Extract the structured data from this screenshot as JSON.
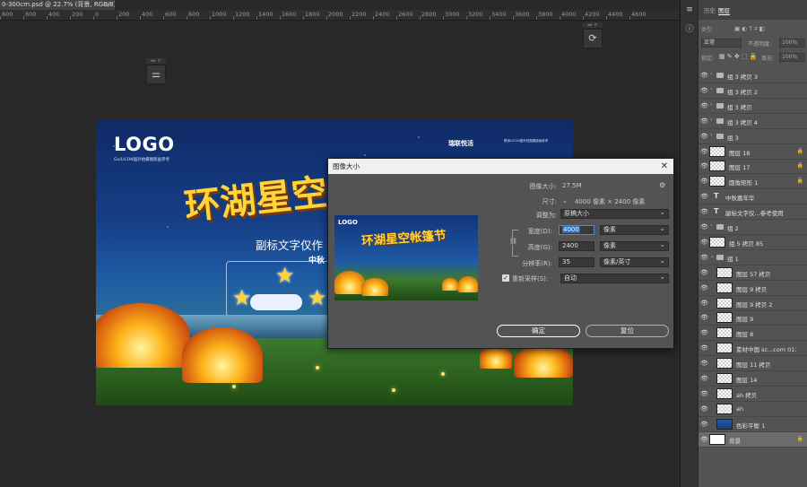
{
  "document_tab": {
    "title": "0-300cm.psd @ 22.7% (背景, RGB/8) *",
    "close": "×"
  },
  "ruler": {
    "labels": [
      "800",
      "600",
      "400",
      "200",
      "0",
      "200",
      "400",
      "600",
      "800",
      "1000",
      "1200",
      "1400",
      "1600",
      "1800",
      "2000",
      "2200",
      "2400",
      "2600",
      "2800",
      "3000",
      "3200",
      "3400",
      "3600",
      "3800",
      "4000",
      "4200",
      "4400",
      "4600"
    ]
  },
  "poster": {
    "logo": "LOGO",
    "logo_sub": "Go/LICON国外拍摄图版画参考",
    "brand": "瑞联悦活",
    "brand_sub": "联创LICON国外拍摄图版画参考",
    "title": "环湖星空",
    "subtitle": "副标文字仅作",
    "moon_title": "中秋"
  },
  "dialog": {
    "title": "图像大小",
    "image_size_label": "图像大小:",
    "image_size_value": "27.5M",
    "dimensions_label": "尺寸:",
    "dimensions_value": "4000 像素 × 2400 像素",
    "fit_label": "调整为:",
    "fit_value": "原稿大小",
    "width_label": "宽度(D):",
    "width_value": "4000",
    "width_unit": "像素",
    "height_label": "高度(G):",
    "height_value": "2400",
    "height_unit": "像素",
    "resolution_label": "分辨率(R):",
    "resolution_value": "35",
    "resolution_unit": "像素/英寸",
    "resample_label": "重新采样(S):",
    "resample_value": "自动",
    "ok_label": "确定",
    "reset_label": "复位",
    "preview_logo": "LOGO",
    "preview_title": "环湖星空帐篷节"
  },
  "panels": {
    "tabs": [
      "历史",
      "图层"
    ],
    "search_placeholder": "类型",
    "blend_mode": "正常",
    "opacity_label": "不透明度:",
    "opacity_value": "100%",
    "lock_label": "锁定:",
    "fill_label": "填充:",
    "fill_value": "100%"
  },
  "layers": [
    {
      "name": "组 3 拷贝 3",
      "kind": "group",
      "locked": false,
      "selected": false
    },
    {
      "name": "组 3 拷贝 2",
      "kind": "group",
      "locked": false,
      "selected": false
    },
    {
      "name": "组 3 拷贝",
      "kind": "group",
      "locked": false,
      "selected": false
    },
    {
      "name": "组 3 拷贝 4",
      "kind": "group",
      "locked": false,
      "selected": false
    },
    {
      "name": "组 3",
      "kind": "group",
      "locked": false,
      "selected": false
    },
    {
      "name": "图层 18",
      "kind": "pixel",
      "locked": true,
      "selected": false
    },
    {
      "name": "图层 17",
      "kind": "pixel",
      "locked": true,
      "selected": false
    },
    {
      "name": "圆角矩形 1",
      "kind": "pixel",
      "locked": true,
      "selected": false
    },
    {
      "name": "中秋嘉年华",
      "kind": "text",
      "locked": false,
      "selected": false
    },
    {
      "name": "副标文字仅...参考使用",
      "kind": "text",
      "locked": false,
      "selected": false
    },
    {
      "name": "组 2",
      "kind": "group",
      "locked": false,
      "selected": false
    },
    {
      "name": "组 5 拷贝 85",
      "kind": "pixel",
      "locked": false,
      "selected": false
    },
    {
      "name": "组 1",
      "kind": "group-open",
      "locked": false,
      "selected": false
    },
    {
      "name": "图层 57 拷贝",
      "kind": "pixel",
      "locked": false,
      "selected": false
    },
    {
      "name": "图层 9 拷贝",
      "kind": "pixel",
      "locked": false,
      "selected": false
    },
    {
      "name": "图层 9 拷贝 2",
      "kind": "pixel",
      "locked": false,
      "selected": false
    },
    {
      "name": "图层 9",
      "kind": "pixel",
      "locked": false,
      "selected": false
    },
    {
      "name": "图层 8",
      "kind": "pixel",
      "locked": false,
      "selected": false
    },
    {
      "name": "素材中国 sc...com 013",
      "kind": "pixel",
      "locked": false,
      "selected": false
    },
    {
      "name": "图层 11 拷贝",
      "kind": "pixel",
      "locked": false,
      "selected": false
    },
    {
      "name": "图层 14",
      "kind": "pixel",
      "locked": false,
      "selected": false
    },
    {
      "name": "ah 拷贝",
      "kind": "pixel",
      "locked": false,
      "selected": false
    },
    {
      "name": "ah",
      "kind": "pixel",
      "locked": false,
      "selected": false
    },
    {
      "name": "色彩平衡 1",
      "kind": "blue",
      "locked": false,
      "selected": false
    },
    {
      "name": "背景",
      "kind": "white",
      "locked": true,
      "selected": true
    }
  ],
  "colors": {
    "canvas_bg": "#282828",
    "panel_bg": "#535353",
    "accent": "#2e6fc2",
    "poster_title": "#ffd33a"
  }
}
